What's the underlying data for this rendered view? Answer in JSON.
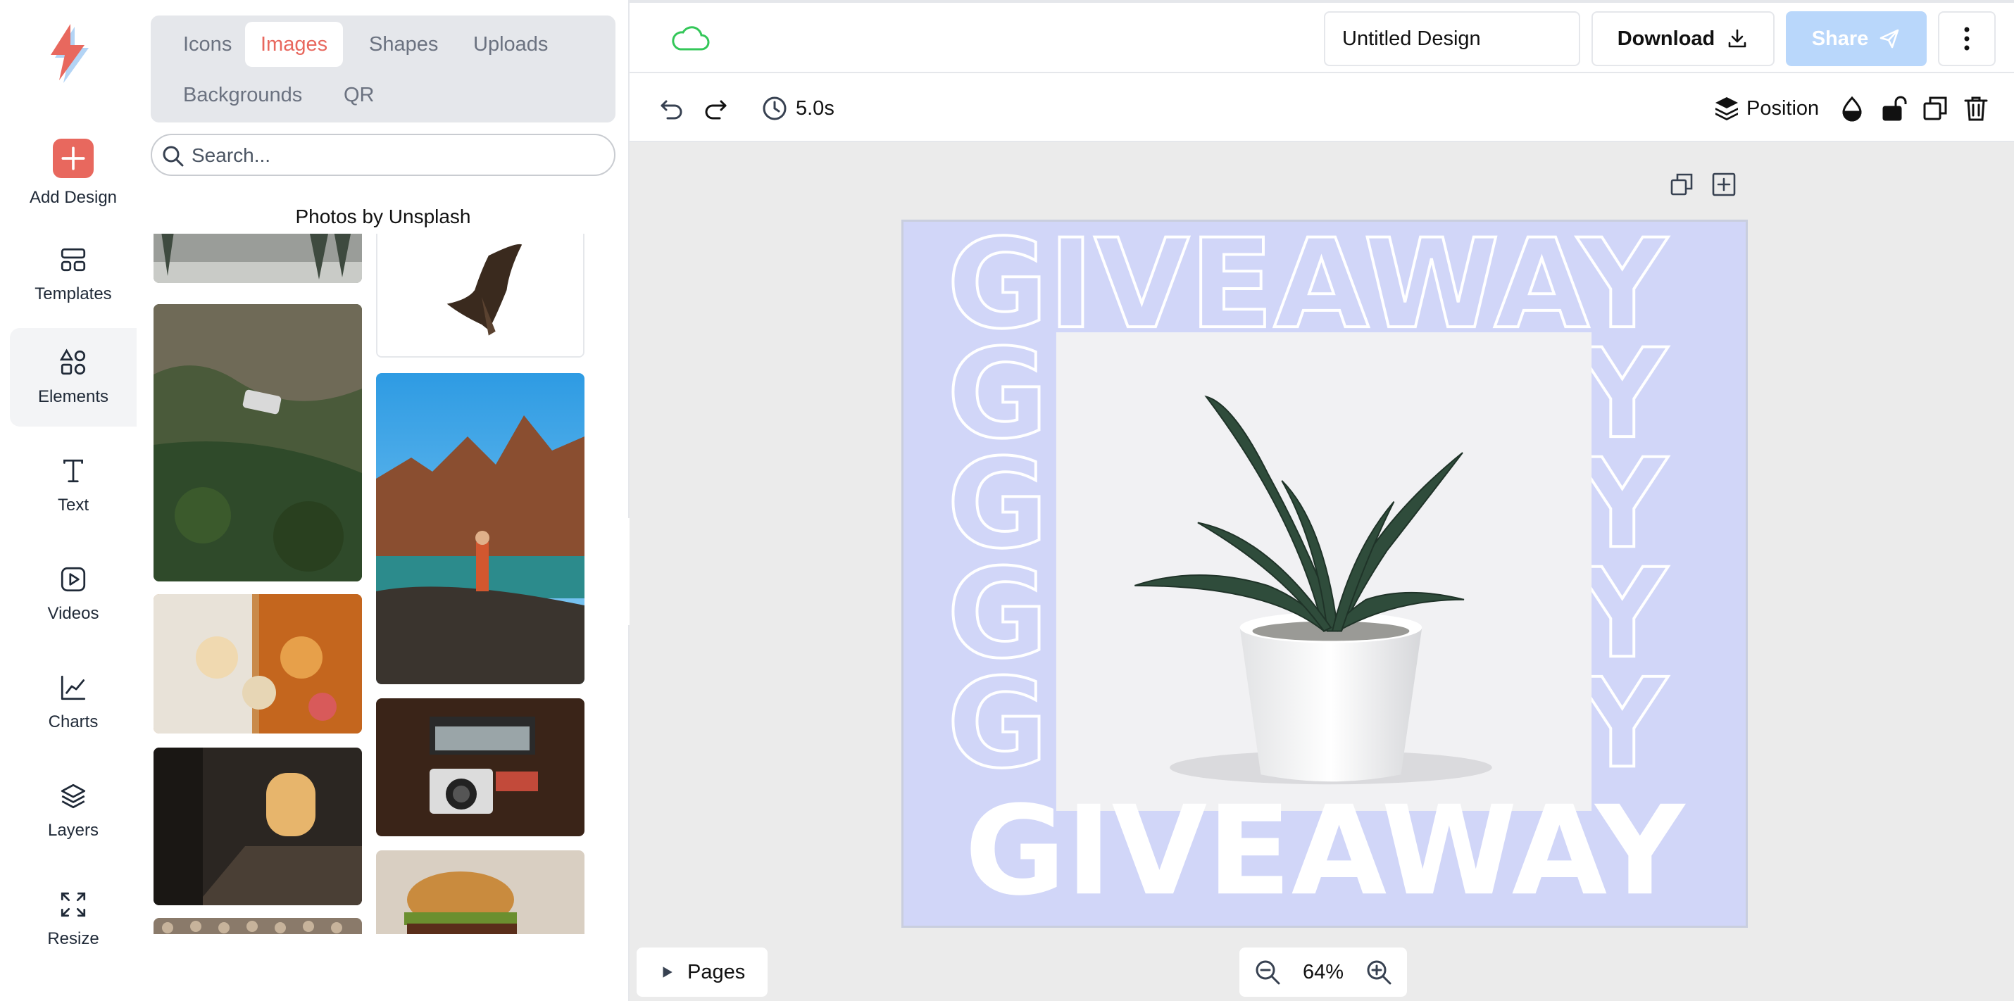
{
  "colors": {
    "accent": "#e8685e",
    "share_disabled": "#b9d7fb",
    "canvas_bg": "#ebebeb",
    "design_bg": "#d1d6f8",
    "cloud": "#34c759"
  },
  "sidebar": {
    "items": [
      {
        "label": "Add Design",
        "icon": "plus-icon"
      },
      {
        "label": "Templates",
        "icon": "templates-icon"
      },
      {
        "label": "Elements",
        "icon": "elements-icon",
        "active": true
      },
      {
        "label": "Text",
        "icon": "text-icon"
      },
      {
        "label": "Videos",
        "icon": "video-icon"
      },
      {
        "label": "Charts",
        "icon": "chart-icon"
      },
      {
        "label": "Layers",
        "icon": "layers-icon"
      },
      {
        "label": "Resize",
        "icon": "resize-icon"
      }
    ]
  },
  "panel": {
    "tabs": [
      "Icons",
      "Images",
      "Shapes",
      "Uploads",
      "Backgrounds",
      "QR"
    ],
    "active_tab": "Images",
    "search_placeholder": "Search...",
    "section_title": "Photos by Unsplash"
  },
  "header": {
    "design_title": "Untitled Design",
    "download_label": "Download",
    "share_label": "Share"
  },
  "toolbar": {
    "duration": "5.0s",
    "position_label": "Position"
  },
  "design": {
    "headline": "GIVEAWAY"
  },
  "footer": {
    "pages_label": "Pages",
    "zoom": "64%"
  }
}
